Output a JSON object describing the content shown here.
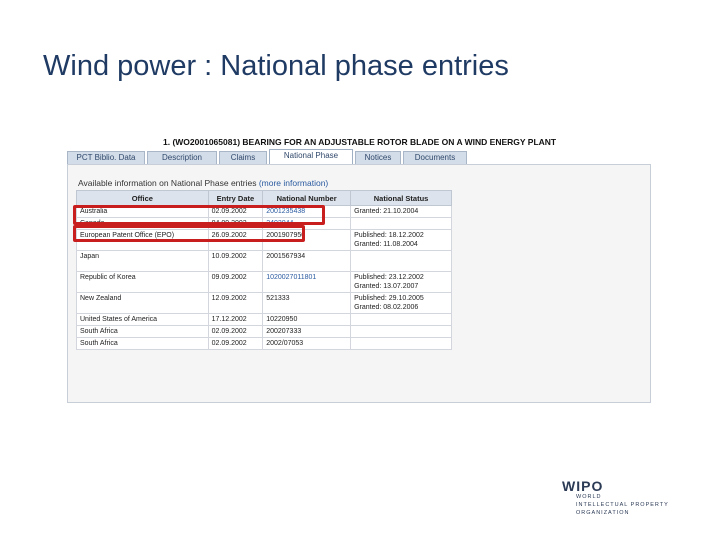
{
  "slide": {
    "title": "Wind power : National phase entries"
  },
  "record": {
    "title": "1. (WO2001065081) BEARING FOR AN ADJUSTABLE ROTOR BLADE ON A WIND ENERGY PLANT"
  },
  "tabs": [
    {
      "label": "PCT Biblio. Data",
      "active": false
    },
    {
      "label": "Description",
      "active": false
    },
    {
      "label": "Claims",
      "active": false
    },
    {
      "label": "National Phase",
      "active": true
    },
    {
      "label": "Notices",
      "active": false
    },
    {
      "label": "Documents",
      "active": false
    }
  ],
  "panel": {
    "available_label": "Available information on National Phase entries",
    "more_link": "(more information)"
  },
  "table": {
    "headers": [
      "Office",
      "Entry Date",
      "National Number",
      "National Status"
    ],
    "rows": [
      {
        "office": "Australia",
        "entry_date": "02.09.2002",
        "number": "2001235438",
        "status_1": "Granted: 21.10.2004",
        "status_2": ""
      },
      {
        "office": "Canada",
        "entry_date": "04.09.2002",
        "number": "2402044",
        "status_1": "",
        "status_2": ""
      },
      {
        "office": "European Patent Office (EPO)",
        "entry_date": "26.09.2002",
        "number": "2001907950",
        "status_1": "Published: 18.12.2002",
        "status_2": "Granted: 11.08.2004"
      },
      {
        "office": "Japan",
        "entry_date": "10.09.2002",
        "number": "2001567934",
        "status_1": "",
        "status_2": ""
      },
      {
        "office": "Republic of Korea",
        "entry_date": "09.09.2002",
        "number": "1020027011801",
        "status_1": "Published: 23.12.2002",
        "status_2": "Granted: 13.07.2007"
      },
      {
        "office": "New Zealand",
        "entry_date": "12.09.2002",
        "number": "521333",
        "status_1": "Published: 29.10.2005",
        "status_2": "Granted: 08.02.2006"
      },
      {
        "office": "United States of America",
        "entry_date": "17.12.2002",
        "number": "10220950",
        "status_1": "",
        "status_2": ""
      },
      {
        "office": "South Africa",
        "entry_date": "02.09.2002",
        "number": "200207333",
        "status_1": "",
        "status_2": ""
      },
      {
        "office": "South Africa",
        "entry_date": "02.09.2002",
        "number": "2002/07053",
        "status_1": "",
        "status_2": ""
      }
    ]
  },
  "logo": {
    "mark": "WIPO",
    "line1": "WORLD",
    "line2": "INTELLECTUAL PROPERTY",
    "line3": "ORGANIZATION"
  },
  "colors": {
    "title": "#1f3a63",
    "highlight": "#c81e1e",
    "link": "#2a5aa0"
  }
}
